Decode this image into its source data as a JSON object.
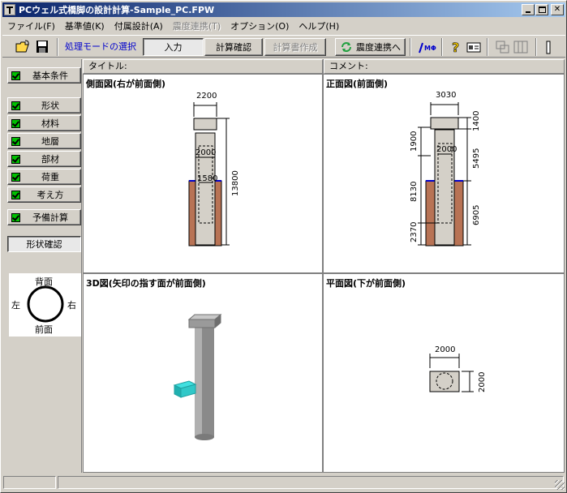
{
  "window": {
    "title": "PCウェル式橋脚の設計計算-Sample_PC.FPW"
  },
  "menu": [
    {
      "label": "ファイル(F)",
      "enabled": true
    },
    {
      "label": "基準値(K)",
      "enabled": true
    },
    {
      "label": "付属設計(A)",
      "enabled": true
    },
    {
      "label": "震度連携(T)",
      "enabled": false
    },
    {
      "label": "オプション(O)",
      "enabled": true
    },
    {
      "label": "ヘルプ(H)",
      "enabled": true
    }
  ],
  "toolbar": {
    "mode_label": "処理モードの選択",
    "input_label": "入力",
    "calc_check_label": "計算確認",
    "report_label": "計算書作成",
    "seismic_label": "震度連携へ",
    "mf_label": "MΦ"
  },
  "sidebar": {
    "basic_label": "基本条件",
    "items": [
      "形状",
      "材料",
      "地層",
      "部材",
      "荷重",
      "考え方"
    ],
    "prelim_label": "予備計算",
    "shape_check_label": "形状確認"
  },
  "orientation": {
    "back": "背面",
    "left": "左",
    "right": "右",
    "front": "前面"
  },
  "headers": {
    "title_label": "タイトル:",
    "comment_label": "コメント:"
  },
  "panes": {
    "side": {
      "title": "側面図(右が前面側)",
      "dims": {
        "top_width": "2200",
        "mid_width": "2000",
        "low_width": "1580",
        "height": "13800"
      }
    },
    "front": {
      "title": "正面図(前面側)",
      "dims": {
        "top_width": "3030",
        "mid_width": "2000",
        "left_upper": "1900",
        "left_mid": "8130",
        "left_low": "2370",
        "right_top": "1400",
        "right_mid": "5495",
        "right_low": "6905"
      }
    },
    "view3d": {
      "title": "3D図(矢印の指す面が前面側)"
    },
    "plan": {
      "title": "平面図(下が前面側)",
      "dims": {
        "width": "2000",
        "depth": "2000"
      }
    }
  },
  "colors": {
    "title_start": "#0a246a",
    "title_end": "#a6caf0",
    "ground": "#b87355",
    "ground_line": "#0000cc",
    "mode_text": "#0000cc",
    "check_green": "#00c000"
  }
}
